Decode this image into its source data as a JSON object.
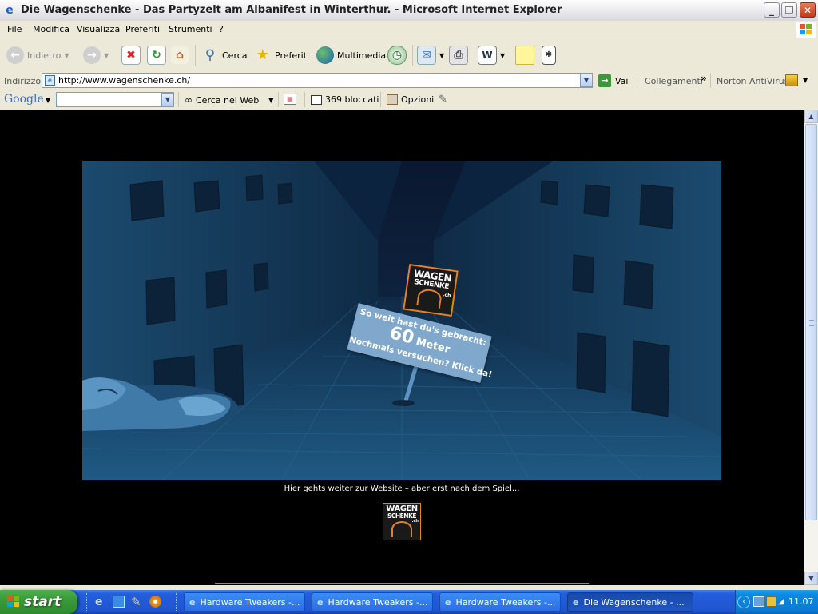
{
  "window": {
    "title": "Die Wagenschenke - Das Partyzelt am Albanifest in Winterthur. - Microsoft Internet Explorer"
  },
  "menu": [
    "File",
    "Modifica",
    "Visualizza",
    "Preferiti",
    "Strumenti",
    "?"
  ],
  "toolbar": {
    "back_label": "Indietro",
    "search_label": "Cerca",
    "favorites_label": "Preferiti",
    "multimedia_label": "Multimedia"
  },
  "addressbar": {
    "label": "Indirizzo",
    "url": "http://www.wagenschenke.ch/",
    "go_label": "Vai",
    "links_label": "Collegamenti",
    "links_chevron": "»",
    "norton_label": "Norton AntiVirus"
  },
  "googlebar": {
    "logo": "Google",
    "search_value": "",
    "search_web_label": "Cerca nel Web",
    "blocked_label": "369 bloccati",
    "options_label": "Opzioni"
  },
  "page": {
    "sign": {
      "brand_line1": "WAGEN",
      "brand_line2": "SCHENKE",
      "brand_suffix": ".ch",
      "line1": "So weit hast du's gebracht:",
      "distance_number": "60",
      "distance_unit": "Meter",
      "line3": "Nochmals versuchen? Klick da!"
    },
    "caption": "Hier gehts weiter zur Website – aber erst nach dem Spiel...",
    "logo_line1": "WAGEN",
    "logo_line2": "SCHENKE",
    "logo_suffix": ".ch"
  },
  "taskbar": {
    "start_label": "start",
    "tasks": [
      {
        "label": "Hardware Tweakers -...",
        "active": false
      },
      {
        "label": "Hardware Tweakers -...",
        "active": false
      },
      {
        "label": "Hardware Tweakers -...",
        "active": false
      },
      {
        "label": "Die Wagenschenke - ...",
        "active": true
      }
    ],
    "clock": "11.07"
  },
  "colors": {
    "xp_blue": "#245edb",
    "sign_blue": "#7fa8cc",
    "logo_orange": "#e8821e",
    "scene_dark": "#0d2238"
  }
}
